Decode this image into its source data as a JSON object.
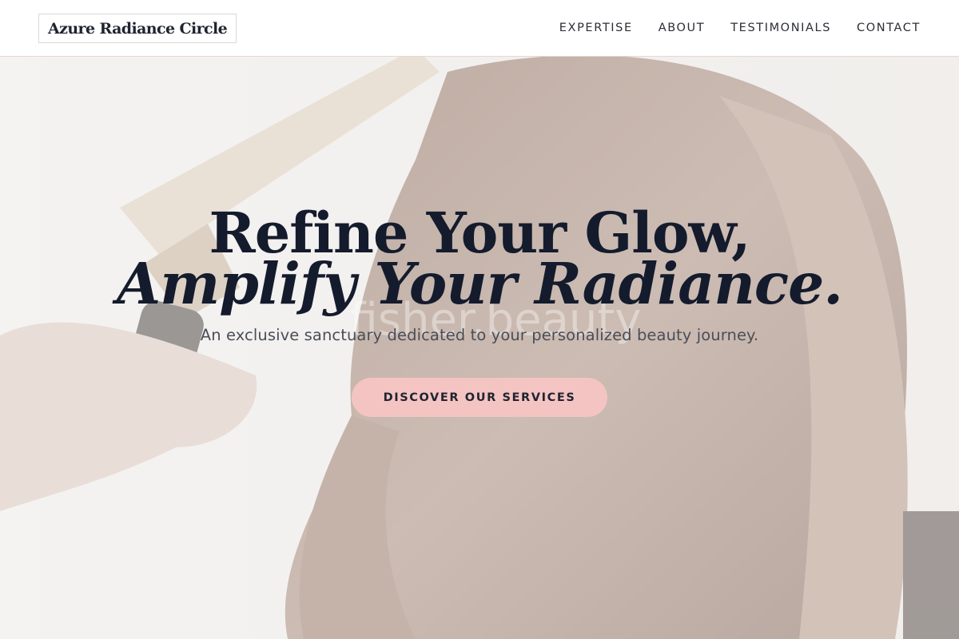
{
  "header": {
    "logo": "Azure Radiance Circle",
    "nav": [
      "EXPERTISE",
      "ABOUT",
      "TESTIMONIALS",
      "CONTACT"
    ]
  },
  "hero": {
    "headline_line1": "Refine Your Glow,",
    "headline_line2": "Amplify Your Radiance.",
    "subheadline": "An exclusive sanctuary dedicated to your personalized beauty journey.",
    "cta_label": "DISCOVER OUR SERVICES",
    "watermark": "fisher.beauty"
  },
  "colors": {
    "accent": "#f4c4c2",
    "heading": "#141b2c",
    "text": "#4a4e58"
  }
}
